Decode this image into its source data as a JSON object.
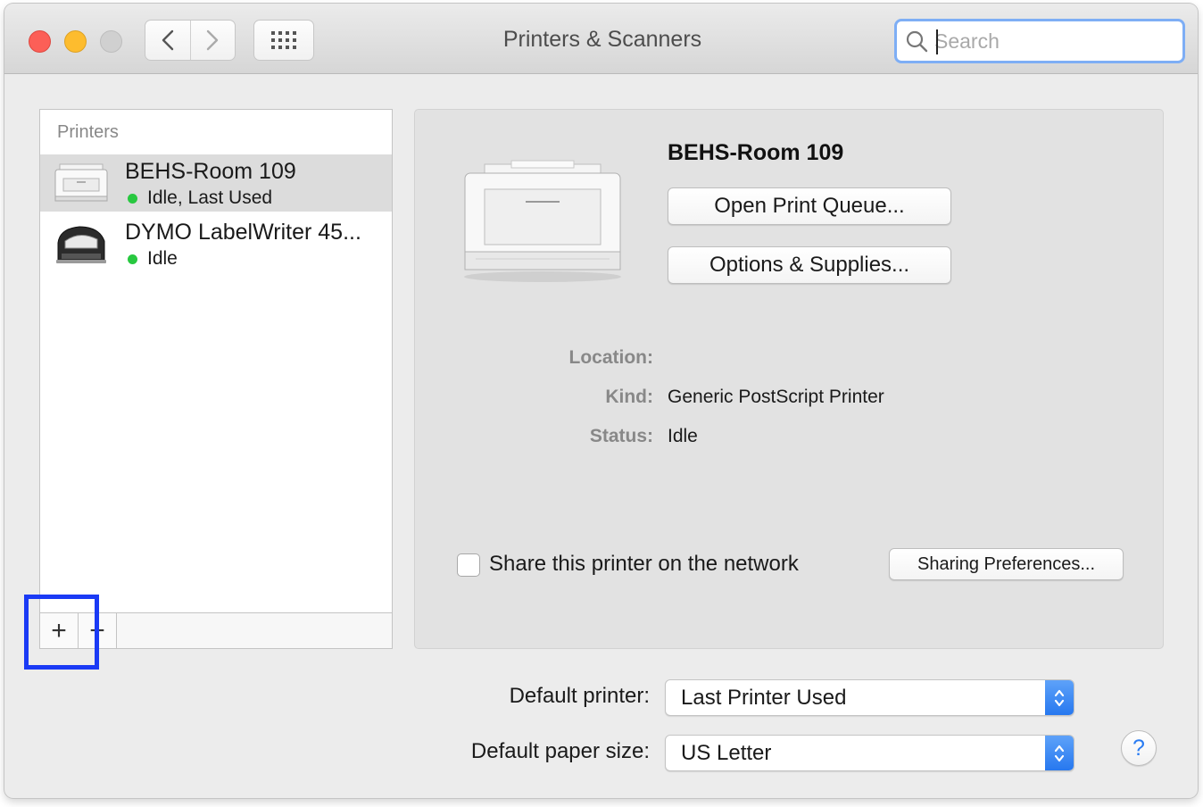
{
  "window": {
    "title": "Printers & Scanners"
  },
  "search": {
    "placeholder": "Search"
  },
  "printers_list": {
    "header": "Printers",
    "items": [
      {
        "name": "BEHS-Room 109",
        "status": "Idle, Last Used",
        "status_color": "#28c840",
        "selected": true,
        "icon": "laser-printer-icon"
      },
      {
        "name": "DYMO LabelWriter 45...",
        "status": "Idle",
        "status_color": "#28c840",
        "selected": false,
        "icon": "label-printer-icon"
      }
    ],
    "add_label": "+",
    "remove_label": "−"
  },
  "detail": {
    "printer_name": "BEHS-Room 109",
    "open_queue_label": "Open Print Queue...",
    "options_label": "Options & Supplies...",
    "location_label": "Location:",
    "location_value": "",
    "kind_label": "Kind:",
    "kind_value": "Generic PostScript Printer",
    "status_label": "Status:",
    "status_value": "Idle",
    "share_label": "Share this printer on the network",
    "share_checked": false,
    "sharing_prefs_label": "Sharing Preferences..."
  },
  "defaults": {
    "printer_label": "Default printer:",
    "printer_value": "Last Printer Used",
    "paper_label": "Default paper size:",
    "paper_value": "US Letter"
  },
  "help_label": "?",
  "colors": {
    "accent": "#2778ef",
    "highlight_box": "#1a3af5",
    "close": "#fc5f57",
    "minimize": "#fdbc2e",
    "status_idle": "#28c840"
  }
}
